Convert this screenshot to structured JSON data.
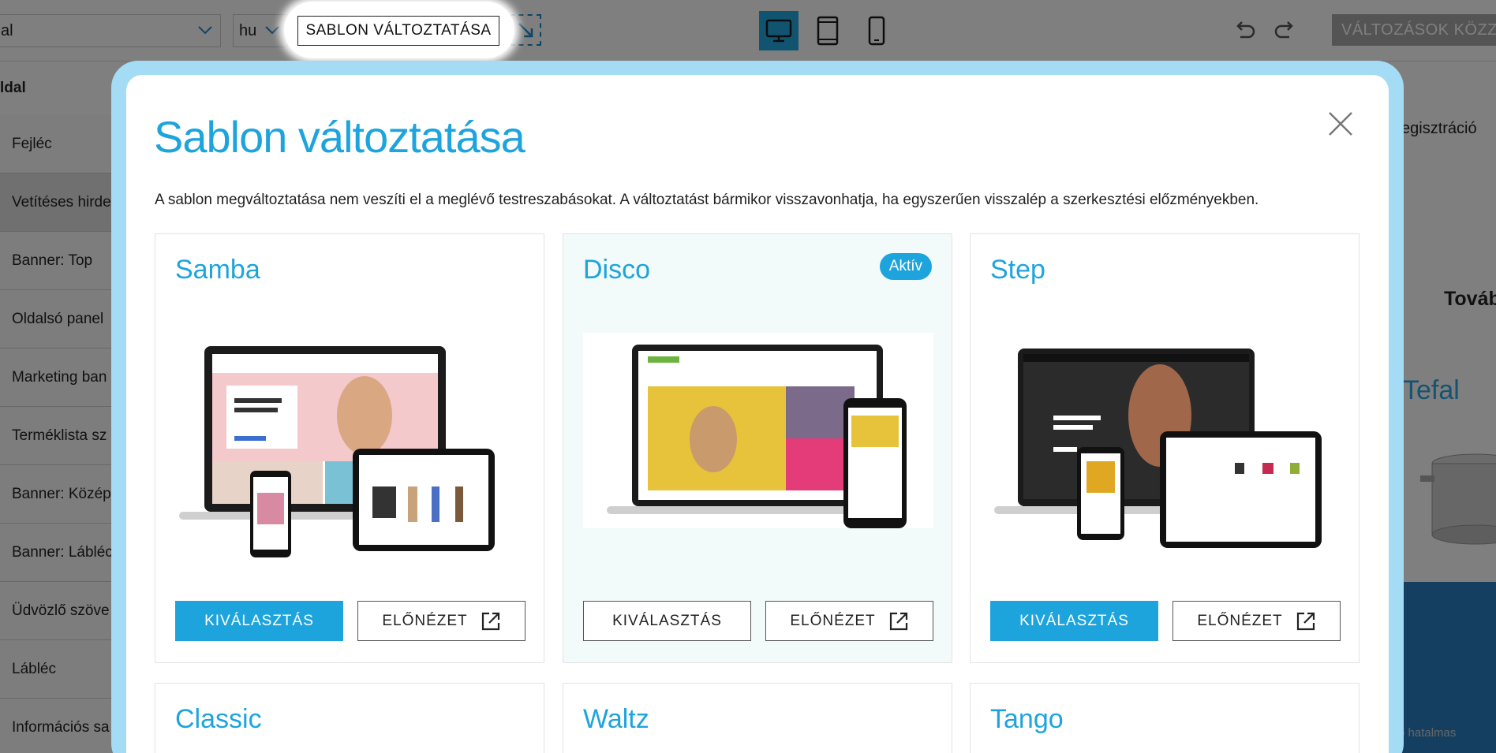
{
  "editor": {
    "page_select_value": "al",
    "language_value": "hu",
    "template_button_label": "SABLON VÁLTOZTATÁSA",
    "publish_label": "VÁLTOZÁSOK KÖZZÉ",
    "sidebar_heading": "ldal",
    "sidebar_items": [
      "Fejléc",
      "Vetítéses hirde",
      "Banner: Top",
      "Oldalsó panel",
      "Marketing ban",
      "Terméklista sz",
      "Banner: Közép",
      "Banner: Lábléc",
      "Üdvözlő szöve",
      "Lábléc",
      "Információs sa"
    ],
    "preview_registration": "egisztráció",
    "preview_more": "Tovább",
    "preview_brand": "Tefal",
    "preview_footer_text": "ő hatalmas"
  },
  "modal": {
    "title": "Sablon változtatása",
    "description": "A sablon megváltoztatása nem veszíti el a meglévő testreszabásokat. A változtatást bármikor visszavonhatja, ha egyszerűen visszalép a szerkesztési előzményekben.",
    "templates": [
      {
        "name": "Samba",
        "active": false,
        "select_label": "KIVÁLASZTÁS",
        "preview_label": "ELŐNÉZET"
      },
      {
        "name": "Disco",
        "active": true,
        "badge": "Aktív",
        "select_label": "KIVÁLASZTÁS",
        "preview_label": "ELŐNÉZET"
      },
      {
        "name": "Step",
        "active": false,
        "select_label": "KIVÁLASZTÁS",
        "preview_label": "ELŐNÉZET"
      },
      {
        "name": "Classic"
      },
      {
        "name": "Waltz"
      },
      {
        "name": "Tango"
      }
    ]
  },
  "colors": {
    "accent": "#1ea4dd",
    "frame": "#a5dcf5",
    "publish_disabled": "#a9a9a9"
  }
}
